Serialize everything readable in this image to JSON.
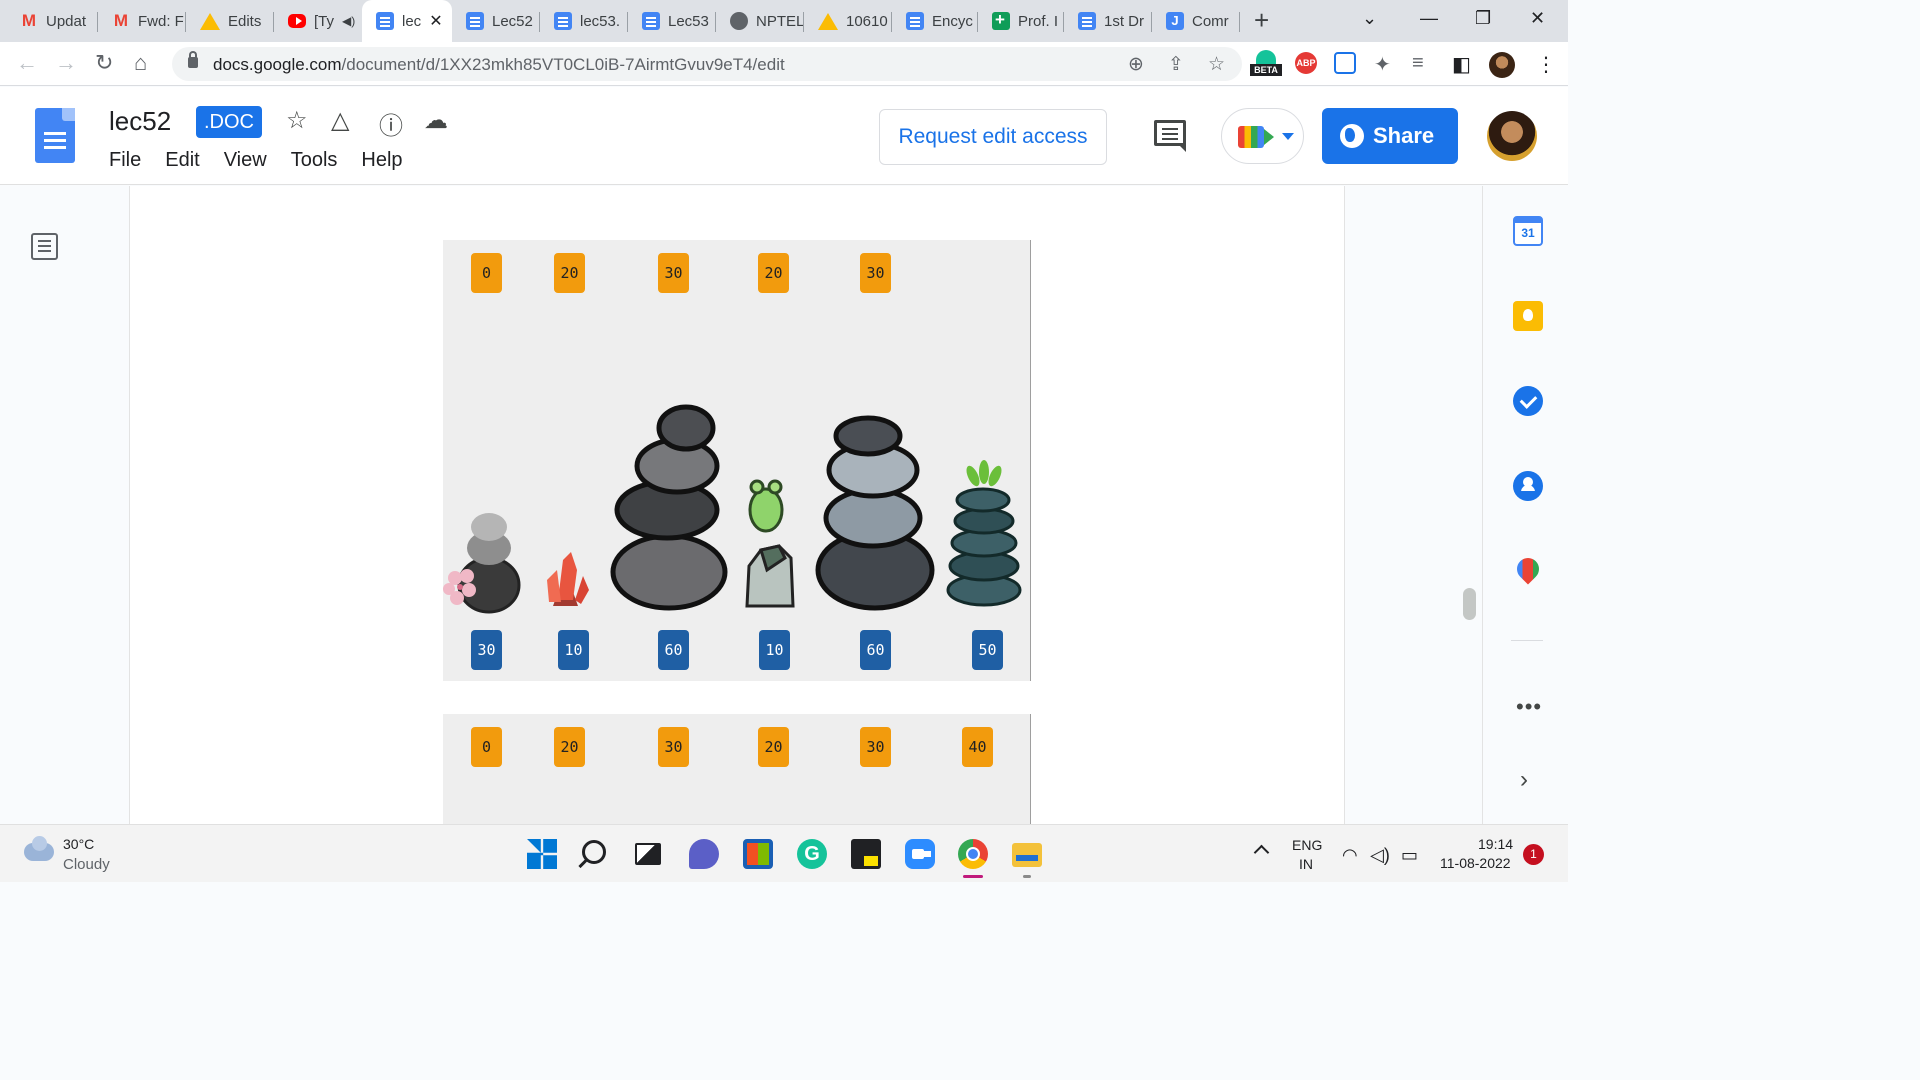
{
  "browser": {
    "tabs": [
      {
        "title": "Updat",
        "icon": "gmail-icon"
      },
      {
        "title": "Fwd: F",
        "icon": "gmail-icon"
      },
      {
        "title": "Edits",
        "icon": "drive-icon"
      },
      {
        "title": "[Ty",
        "icon": "youtube-icon"
      },
      {
        "title": "lec",
        "icon": "docs-icon",
        "active": true
      },
      {
        "title": "Lec52",
        "icon": "docs-icon"
      },
      {
        "title": "lec53.",
        "icon": "docs-icon"
      },
      {
        "title": "Lec53",
        "icon": "docs-icon"
      },
      {
        "title": "NPTEL",
        "icon": "globe-icon"
      },
      {
        "title": "10610",
        "icon": "drive-icon"
      },
      {
        "title": "Encyc",
        "icon": "docs-icon"
      },
      {
        "title": "Prof. I",
        "icon": "sheets-icon"
      },
      {
        "title": "1st Dr",
        "icon": "docs-icon"
      },
      {
        "title": "Comr",
        "icon": "jamboard-icon"
      }
    ],
    "new_tab": "+",
    "url_host": "docs.google.com",
    "url_path": "/document/d/1XX23mkh85VT0CL0iB-7AirmtGvuv9eT4/edit",
    "extension_beta_label": "BETA",
    "extension_abp_label": "ABP"
  },
  "doc": {
    "title": "lec52",
    "badge": ".DOC",
    "menu": [
      "File",
      "Edit",
      "View",
      "Tools",
      "Help"
    ],
    "request_access": "Request edit access",
    "share": "Share"
  },
  "panel1": {
    "top_tags": [
      "0",
      "20",
      "30",
      "20",
      "30"
    ],
    "bottom_tags": [
      "30",
      "10",
      "60",
      "10",
      "60",
      "50"
    ]
  },
  "panel2": {
    "top_tags": [
      "0",
      "20",
      "30",
      "20",
      "30",
      "40"
    ]
  },
  "side_panel": {
    "calendar_day": "31",
    "more": "•••",
    "collapse": "›"
  },
  "taskbar": {
    "temperature": "30°C",
    "weather": "Cloudy",
    "lang_line1": "ENG",
    "lang_line2": "IN",
    "time": "19:14",
    "date": "11-08-2022",
    "notifications": "1"
  },
  "colors": {
    "accent": "#1a73e8",
    "top_tag": "#f29b0d",
    "bottom_tag": "#1f5fa4"
  }
}
